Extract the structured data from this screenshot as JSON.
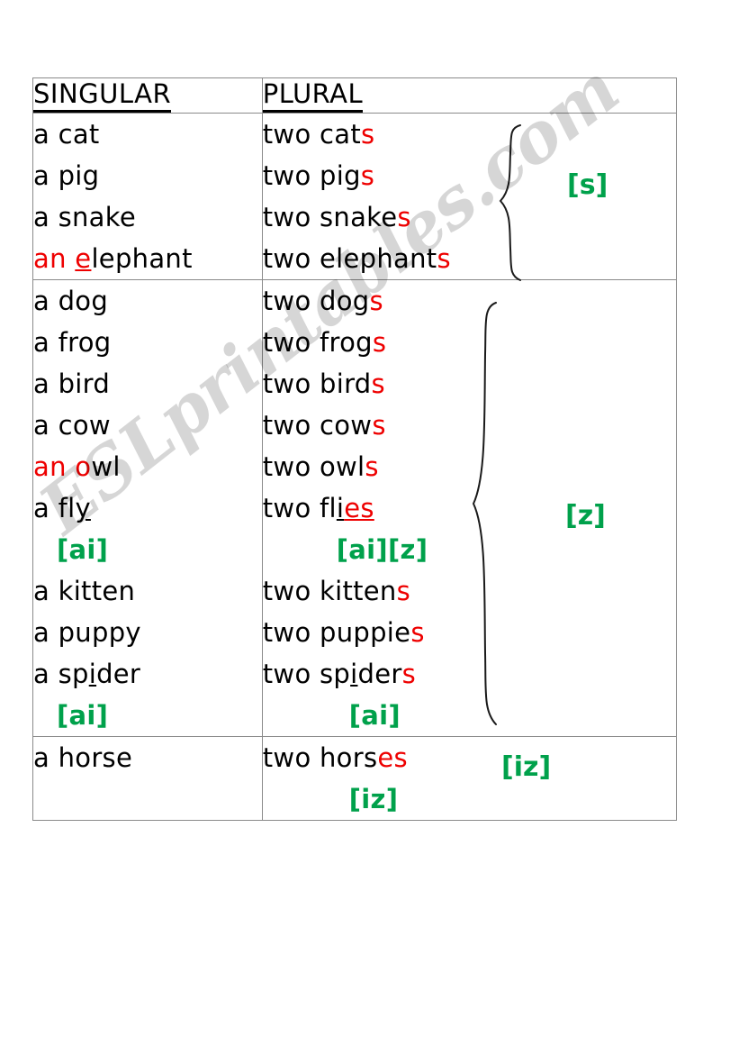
{
  "document": {
    "type": "worksheet",
    "topic": "Singular and plural nouns with plural -s pronunciation",
    "watermark": "ESLprintables.com"
  },
  "colors": {
    "red": "#ee0000",
    "green": "#00a14b",
    "black": "#000000",
    "border": "#8a8a8a"
  },
  "table": {
    "headers": {
      "singular": "SINGULAR",
      "plural": "PLURAL"
    },
    "sections": [
      {
        "id": "section-s",
        "sound": "[s]",
        "rows": [
          {
            "singular": "a cat",
            "plural": "two cats"
          },
          {
            "singular": "a pig",
            "plural": "two pigs"
          },
          {
            "singular": "a snake",
            "plural": "two snakes"
          },
          {
            "singular": "an elephant",
            "plural": "two elephants"
          }
        ]
      },
      {
        "id": "section-z",
        "sound": "[z]",
        "rows": [
          {
            "singular": "a dog",
            "plural": "two dogs"
          },
          {
            "singular": "a frog",
            "plural": "two frogs"
          },
          {
            "singular": "a bird",
            "plural": "two birds"
          },
          {
            "singular": "a cow",
            "plural": "two cows"
          },
          {
            "singular": "an owl",
            "plural": "two owls"
          },
          {
            "singular": "a fly",
            "plural": "two flies"
          },
          {
            "singular": "a kitten",
            "plural": "two kittens"
          },
          {
            "singular": "a puppy",
            "plural": "two puppies"
          },
          {
            "singular": "a spider",
            "plural": "two spiders"
          }
        ],
        "phonetics": {
          "fly_singular": "[ai]",
          "flies_plural": "[ai][z]",
          "spider_singular": "[ai]",
          "spiders_plural": "[ai]"
        }
      },
      {
        "id": "section-iz",
        "sound": "[iz]",
        "rows": [
          {
            "singular": "a horse",
            "plural": "two horses"
          }
        ],
        "phonetics": {
          "horses_plural": "[iz]"
        }
      }
    ]
  },
  "word_parts": {
    "cat": {
      "stem_prefix": "a ",
      "stem": "cat"
    },
    "cats": {
      "stem": "two cat",
      "suffix": "s"
    },
    "pig": {
      "stem_prefix": "a ",
      "stem": "pig"
    },
    "pigs": {
      "stem": "two pig",
      "suffix": "s"
    },
    "snake": {
      "stem_prefix": "a ",
      "stem": "snake"
    },
    "snakes": {
      "stem": "two snake",
      "suffix": "s"
    },
    "elephant_article": "an",
    "elephant_initial": "e",
    "elephant_rest": "lephant",
    "elephants": {
      "stem": "two elephant",
      "suffix": "s"
    },
    "dog": {
      "stem_prefix": "a ",
      "stem": "dog"
    },
    "dogs": {
      "stem": "two dog",
      "suffix": "s"
    },
    "frog": {
      "stem_prefix": "a ",
      "stem": "frog"
    },
    "frogs": {
      "stem": "two frog",
      "suffix": "s"
    },
    "bird": {
      "stem_prefix": "a ",
      "stem": "bird"
    },
    "birds": {
      "stem": "two bird",
      "suffix": "s"
    },
    "cow": {
      "stem_prefix": "a ",
      "stem": "cow"
    },
    "cows": {
      "stem": "two cow",
      "suffix": "s"
    },
    "owl_article": "an",
    "owl_initial": "o",
    "owl_rest": "wl",
    "owls": {
      "stem": "two owl",
      "suffix": "s"
    },
    "fly_prefix": "a fl",
    "fly_y": "y",
    "flies_prefix": "two fl",
    "flies_i": "i",
    "flies_es": "es",
    "kitten": {
      "stem_prefix": "a ",
      "stem": "kitten"
    },
    "kittens": {
      "stem": "two kitten",
      "suffix": "s"
    },
    "puppy": {
      "stem_prefix": "a ",
      "stem": "puppy"
    },
    "puppies": {
      "stem": "two puppie",
      "suffix": "s"
    },
    "spider_prefix": "a sp",
    "spider_i": "i",
    "spider_rest": "der",
    "spiders_prefix": "two sp",
    "spiders_i": "i",
    "spiders_rest": "der",
    "spiders_s": "s",
    "horse": {
      "stem_prefix": "a ",
      "stem": "horse"
    },
    "horses_stem": "two hors",
    "horses_es": "es"
  }
}
